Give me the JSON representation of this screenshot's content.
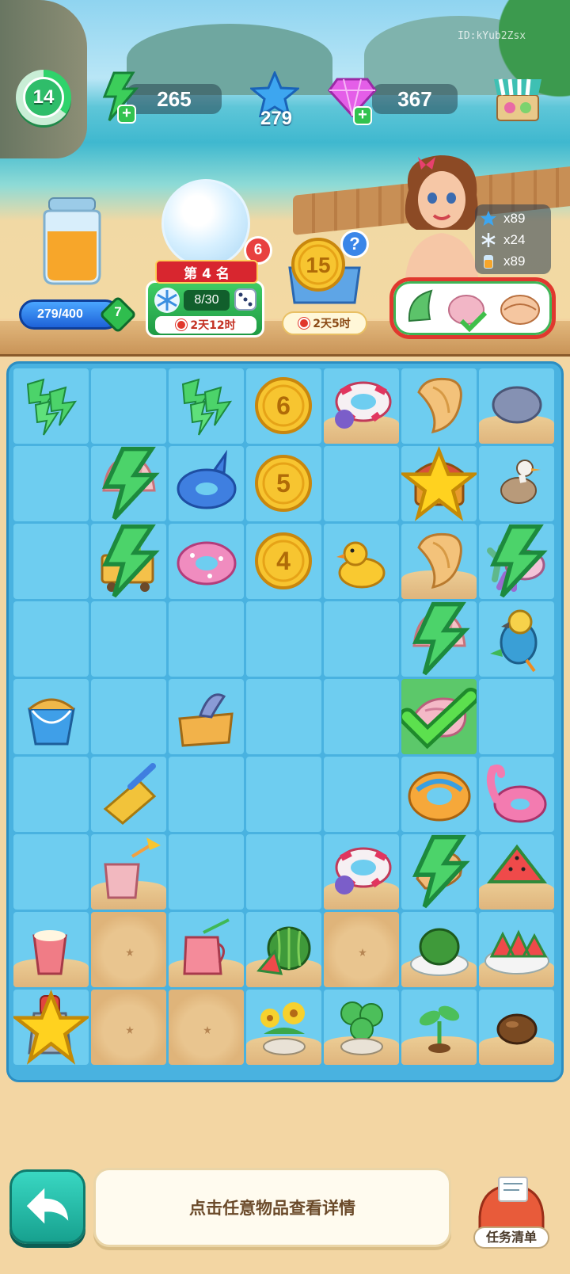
{
  "watermark": "ID:kYub2Zsx",
  "hud": {
    "level": "14",
    "energy": "265",
    "stars": "279",
    "gems": "367",
    "plus": "+"
  },
  "events": {
    "jar_progress": "279/400",
    "jar_gems": "7",
    "globe_badge": "6",
    "rank_label": "第 4 名",
    "rank_progress": "8/30",
    "rank_timer": "2天12时",
    "coin_value": "15",
    "coin_help": "?",
    "coin_timer": "2天5时",
    "rewards": [
      {
        "icon": "star-icon",
        "count": "x89"
      },
      {
        "icon": "snowflake-icon",
        "count": "x24"
      },
      {
        "icon": "juice-icon",
        "count": "x89"
      }
    ]
  },
  "board": {
    "rows": [
      [
        "energy-bolts",
        "empty",
        "energy-bolts",
        "coin-6",
        "swim-ring-sand",
        "conch-shell",
        "grey-stone-sand"
      ],
      [
        "empty",
        "scallop-shell-bolt",
        "dolphin-float",
        "coin-5",
        "empty",
        "treasure-chest-star",
        "seagull"
      ],
      [
        "empty",
        "fruit-cart-bolt",
        "donut-float",
        "coin-4",
        "rubber-duck",
        "conch-shell-sand",
        "coral-shells-bolt"
      ],
      [
        "empty",
        "empty",
        "empty",
        "empty",
        "empty",
        "scallop-shell-bolt",
        "parrot"
      ],
      [
        "sand-bucket",
        "empty",
        "sandal-box",
        "empty",
        "empty",
        "spiral-shell-selected",
        "empty"
      ],
      [
        "empty",
        "shovel",
        "empty",
        "empty",
        "empty",
        "orange-donut-float",
        "flamingo-float"
      ],
      [
        "empty",
        "watermelon-drink-sand",
        "empty",
        "empty",
        "swim-ring-sand",
        "small-shell-bolt",
        "watermelon-slice-sand"
      ],
      [
        "smoothie-sand",
        "sand",
        "juice-jug-sand",
        "watermelon-sand",
        "sand",
        "melon-plate-sand",
        "melon-platter-sand"
      ],
      [
        "juicer-star",
        "sand",
        "sand",
        "flower-pot-sand",
        "clover-pot-sand",
        "sprout-sand",
        "seed-sand"
      ]
    ],
    "coin_labels": {
      "coin-6": "6",
      "coin-5": "5",
      "coin-4": "4"
    }
  },
  "footer": {
    "hint": "点击任意物品查看详情",
    "task_label": "任务清单"
  },
  "colors": {
    "board": "#49b2e0",
    "cell": "#6ecdf0",
    "selected": "#5cc86a",
    "accent_green": "#2fbd6a",
    "ribbon_red": "#d8262f"
  }
}
